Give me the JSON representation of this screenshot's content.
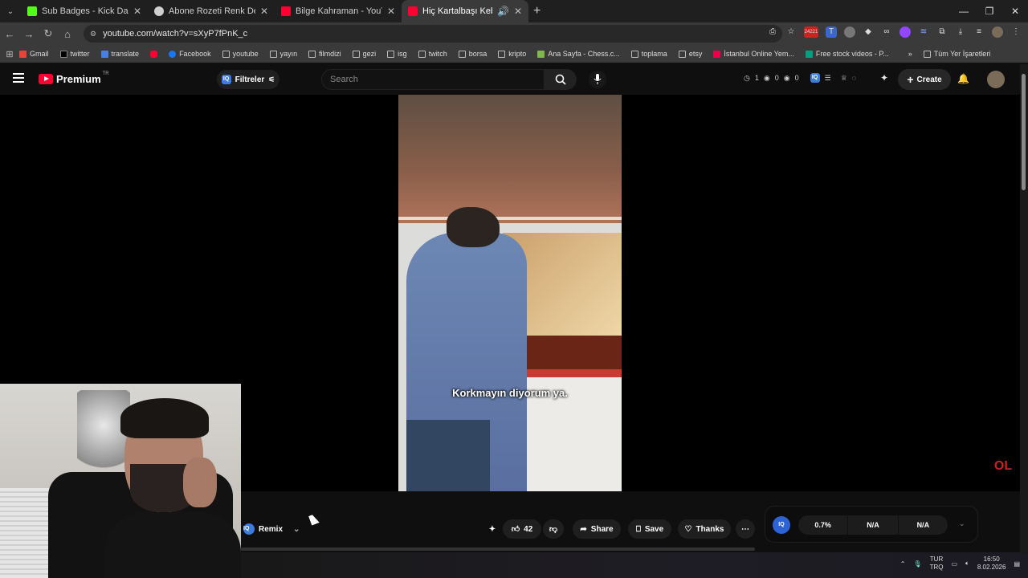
{
  "browser": {
    "tabs": [
      {
        "title": "Sub Badges - Kick Dashboard",
        "color": "#53fc18"
      },
      {
        "title": "Abone Rozeti Renk Değişimi",
        "color": "#d0d0d0"
      },
      {
        "title": "Bilge Kahraman - YouTube",
        "color": "#ff0033"
      },
      {
        "title": "Hiç Kartalbaşı Kebabı Yedin",
        "color": "#ff0033"
      }
    ],
    "url": "youtube.com/watch?v=sXyP7fPnK_c",
    "bookmarks": [
      {
        "label": "Gmail",
        "icon": "gmail-icon"
      },
      {
        "label": "twitter",
        "icon": "x-icon"
      },
      {
        "label": "translate",
        "icon": "translate-icon"
      },
      {
        "label": "",
        "icon": "youtube-icon"
      },
      {
        "label": "Facebook",
        "icon": "facebook-icon"
      },
      {
        "label": "youtube",
        "icon": "folder-icon"
      },
      {
        "label": "yayın",
        "icon": "folder-icon"
      },
      {
        "label": "filmdizi",
        "icon": "folder-icon"
      },
      {
        "label": "gezi",
        "icon": "folder-icon"
      },
      {
        "label": "isg",
        "icon": "folder-icon"
      },
      {
        "label": "twitch",
        "icon": "folder-icon"
      },
      {
        "label": "borsa",
        "icon": "folder-icon"
      },
      {
        "label": "kripto",
        "icon": "folder-icon"
      },
      {
        "label": "Ana Sayfa - Chess.c...",
        "icon": "chess-icon"
      },
      {
        "label": "toplama",
        "icon": "folder-icon"
      },
      {
        "label": "etsy",
        "icon": "folder-icon"
      },
      {
        "label": "İstanbul Online Yem...",
        "icon": "yemeksepeti-icon"
      },
      {
        "label": "Free stock videos - P...",
        "icon": "pexels-icon"
      }
    ],
    "all_bookmarks": "Tüm Yer İşaretleri",
    "ext_badge": "24221"
  },
  "youtube": {
    "logo": "Premium",
    "region": "TR",
    "filters": "Filtreler",
    "search_placeholder": "Search",
    "stats": [
      "1",
      "0",
      "0"
    ],
    "create": "Create"
  },
  "video": {
    "subtitle": "Korkmayın diyorum ya.",
    "watermark": "OL"
  },
  "actions": {
    "remix": "Remix",
    "likes": "42",
    "share": "Share",
    "save": "Save",
    "thanks": "Thanks"
  },
  "iq_panel": {
    "badge": "IQ",
    "values": [
      "0.7%",
      "N/A",
      "N/A"
    ]
  },
  "tray": {
    "lang": "TUR",
    "layout": "TRQ",
    "time": "16:50",
    "date": "8.02.2026"
  }
}
